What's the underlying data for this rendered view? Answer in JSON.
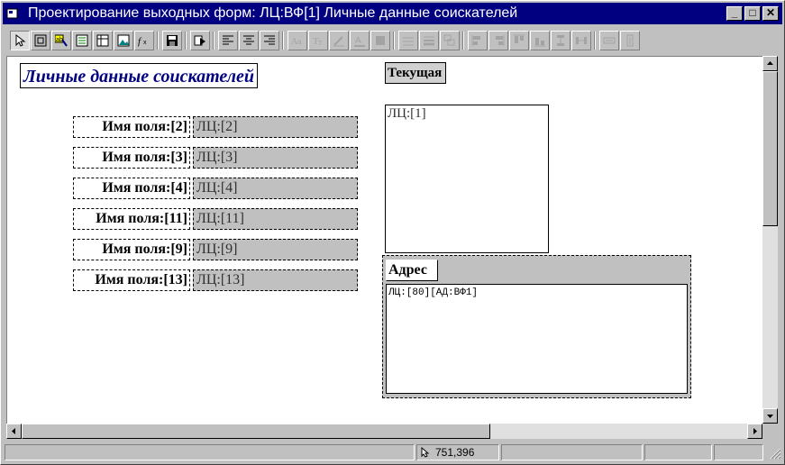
{
  "window": {
    "title": "Проектирование выходных форм: ЛЦ:ВФ[1] Личные данные соискателей",
    "controls": {
      "minimize": "_",
      "maximize": "□",
      "close": "✕"
    }
  },
  "toolbar": {
    "buttons": [
      {
        "name": "select-pointer-icon",
        "pressed": true
      },
      {
        "name": "frame-tool-icon"
      },
      {
        "name": "field-tool-icon"
      },
      {
        "name": "list-tool-icon"
      },
      {
        "name": "table-tool-icon"
      },
      {
        "name": "image-tool-icon"
      },
      {
        "name": "formula-tool-icon"
      },
      {
        "name": "save-icon"
      },
      {
        "name": "run-form-icon"
      },
      {
        "name": "align-left-icon"
      },
      {
        "name": "align-center-icon"
      },
      {
        "name": "align-right-icon"
      },
      {
        "name": "font-name-icon",
        "disabled": true
      },
      {
        "name": "font-size-icon",
        "disabled": true
      },
      {
        "name": "line-color-icon",
        "disabled": true
      },
      {
        "name": "text-color-icon",
        "disabled": true
      },
      {
        "name": "fill-color-icon",
        "disabled": true
      },
      {
        "name": "border-icon",
        "disabled": true
      },
      {
        "name": "border-style-icon",
        "disabled": true
      },
      {
        "name": "group-icon",
        "disabled": true
      },
      {
        "name": "align-objects-left-icon",
        "disabled": true
      },
      {
        "name": "align-objects-right-icon",
        "disabled": true
      },
      {
        "name": "align-objects-top-icon",
        "disabled": true
      },
      {
        "name": "align-objects-bottom-icon",
        "disabled": true
      },
      {
        "name": "space-vertical-icon",
        "disabled": true
      },
      {
        "name": "space-horizontal-icon",
        "disabled": true
      },
      {
        "name": "same-width-icon",
        "disabled": true
      },
      {
        "name": "same-height-icon",
        "disabled": true
      }
    ]
  },
  "form": {
    "title": "Личные данные соискателей",
    "fields": [
      {
        "label": "Имя поля:[2]",
        "value": "ЛЦ:[2]"
      },
      {
        "label": "Имя поля:[3]",
        "value": "ЛЦ:[3]"
      },
      {
        "label": "Имя поля:[4]",
        "value": "ЛЦ:[4]"
      },
      {
        "label": "Имя поля:[11]",
        "value": "ЛЦ:[11]"
      },
      {
        "label": "Имя поля:[9]",
        "value": "ЛЦ:[9]"
      },
      {
        "label": "Имя поля:[13]",
        "value": "ЛЦ:[13]"
      }
    ],
    "current_label": "Текущая",
    "photo_field": "ЛЦ:[1]",
    "address": {
      "label": "Адрес",
      "value": "ЛЦ:[80][АД:ВФ1]"
    }
  },
  "status": {
    "coordinates": "751,396"
  }
}
